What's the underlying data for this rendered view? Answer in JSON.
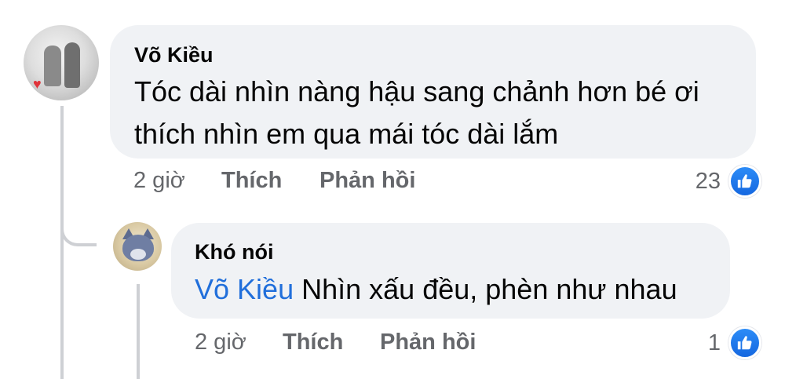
{
  "colors": {
    "bubble_bg": "#f0f2f5",
    "text": "#050505",
    "meta_text": "#65676b",
    "mention": "#216fdb",
    "like_blue": "#1877f2",
    "thread_line": "#ced0d4"
  },
  "comment": {
    "author": "Võ Kiều",
    "text_line1": "Tóc dài nhìn nàng hậu sang chảnh hơn bé ơi",
    "text_line2": "thích nhìn em qua mái tóc dài lắm",
    "time": "2 giờ",
    "like_label": "Thích",
    "reply_label": "Phản hồi",
    "reaction_count": "23",
    "reaction_icon": "thumbs-up-icon"
  },
  "reply": {
    "author": "Khó nói",
    "mention": "Võ Kiều",
    "text": "Nhìn xấu đều, phèn như nhau",
    "time": "2 giờ",
    "like_label": "Thích",
    "reply_label": "Phản hồi",
    "reaction_count": "1",
    "reaction_icon": "thumbs-up-icon"
  }
}
